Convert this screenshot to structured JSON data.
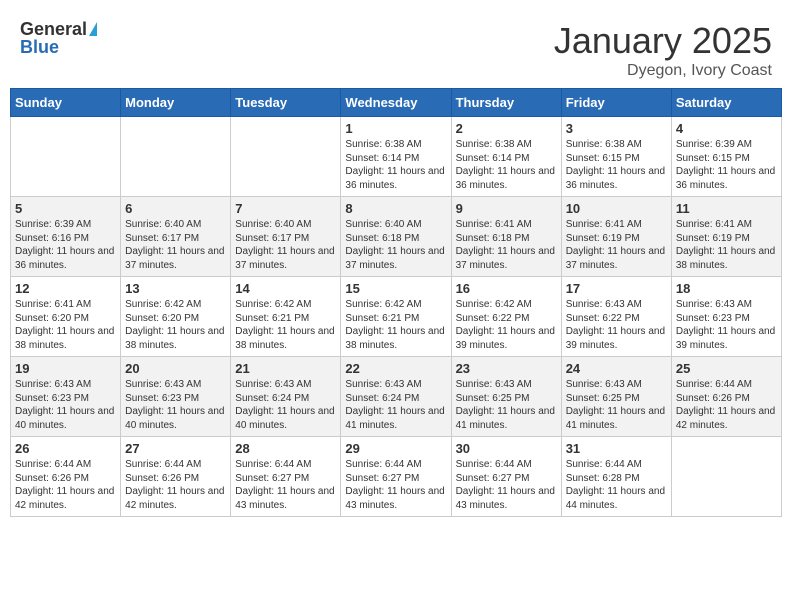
{
  "logo": {
    "general": "General",
    "blue": "Blue"
  },
  "title": {
    "month": "January 2025",
    "location": "Dyegon, Ivory Coast"
  },
  "weekdays": [
    "Sunday",
    "Monday",
    "Tuesday",
    "Wednesday",
    "Thursday",
    "Friday",
    "Saturday"
  ],
  "weeks": [
    [
      {
        "day": "",
        "info": ""
      },
      {
        "day": "",
        "info": ""
      },
      {
        "day": "",
        "info": ""
      },
      {
        "day": "1",
        "info": "Sunrise: 6:38 AM\nSunset: 6:14 PM\nDaylight: 11 hours and 36 minutes."
      },
      {
        "day": "2",
        "info": "Sunrise: 6:38 AM\nSunset: 6:14 PM\nDaylight: 11 hours and 36 minutes."
      },
      {
        "day": "3",
        "info": "Sunrise: 6:38 AM\nSunset: 6:15 PM\nDaylight: 11 hours and 36 minutes."
      },
      {
        "day": "4",
        "info": "Sunrise: 6:39 AM\nSunset: 6:15 PM\nDaylight: 11 hours and 36 minutes."
      }
    ],
    [
      {
        "day": "5",
        "info": "Sunrise: 6:39 AM\nSunset: 6:16 PM\nDaylight: 11 hours and 36 minutes."
      },
      {
        "day": "6",
        "info": "Sunrise: 6:40 AM\nSunset: 6:17 PM\nDaylight: 11 hours and 37 minutes."
      },
      {
        "day": "7",
        "info": "Sunrise: 6:40 AM\nSunset: 6:17 PM\nDaylight: 11 hours and 37 minutes."
      },
      {
        "day": "8",
        "info": "Sunrise: 6:40 AM\nSunset: 6:18 PM\nDaylight: 11 hours and 37 minutes."
      },
      {
        "day": "9",
        "info": "Sunrise: 6:41 AM\nSunset: 6:18 PM\nDaylight: 11 hours and 37 minutes."
      },
      {
        "day": "10",
        "info": "Sunrise: 6:41 AM\nSunset: 6:19 PM\nDaylight: 11 hours and 37 minutes."
      },
      {
        "day": "11",
        "info": "Sunrise: 6:41 AM\nSunset: 6:19 PM\nDaylight: 11 hours and 38 minutes."
      }
    ],
    [
      {
        "day": "12",
        "info": "Sunrise: 6:41 AM\nSunset: 6:20 PM\nDaylight: 11 hours and 38 minutes."
      },
      {
        "day": "13",
        "info": "Sunrise: 6:42 AM\nSunset: 6:20 PM\nDaylight: 11 hours and 38 minutes."
      },
      {
        "day": "14",
        "info": "Sunrise: 6:42 AM\nSunset: 6:21 PM\nDaylight: 11 hours and 38 minutes."
      },
      {
        "day": "15",
        "info": "Sunrise: 6:42 AM\nSunset: 6:21 PM\nDaylight: 11 hours and 38 minutes."
      },
      {
        "day": "16",
        "info": "Sunrise: 6:42 AM\nSunset: 6:22 PM\nDaylight: 11 hours and 39 minutes."
      },
      {
        "day": "17",
        "info": "Sunrise: 6:43 AM\nSunset: 6:22 PM\nDaylight: 11 hours and 39 minutes."
      },
      {
        "day": "18",
        "info": "Sunrise: 6:43 AM\nSunset: 6:23 PM\nDaylight: 11 hours and 39 minutes."
      }
    ],
    [
      {
        "day": "19",
        "info": "Sunrise: 6:43 AM\nSunset: 6:23 PM\nDaylight: 11 hours and 40 minutes."
      },
      {
        "day": "20",
        "info": "Sunrise: 6:43 AM\nSunset: 6:23 PM\nDaylight: 11 hours and 40 minutes."
      },
      {
        "day": "21",
        "info": "Sunrise: 6:43 AM\nSunset: 6:24 PM\nDaylight: 11 hours and 40 minutes."
      },
      {
        "day": "22",
        "info": "Sunrise: 6:43 AM\nSunset: 6:24 PM\nDaylight: 11 hours and 41 minutes."
      },
      {
        "day": "23",
        "info": "Sunrise: 6:43 AM\nSunset: 6:25 PM\nDaylight: 11 hours and 41 minutes."
      },
      {
        "day": "24",
        "info": "Sunrise: 6:43 AM\nSunset: 6:25 PM\nDaylight: 11 hours and 41 minutes."
      },
      {
        "day": "25",
        "info": "Sunrise: 6:44 AM\nSunset: 6:26 PM\nDaylight: 11 hours and 42 minutes."
      }
    ],
    [
      {
        "day": "26",
        "info": "Sunrise: 6:44 AM\nSunset: 6:26 PM\nDaylight: 11 hours and 42 minutes."
      },
      {
        "day": "27",
        "info": "Sunrise: 6:44 AM\nSunset: 6:26 PM\nDaylight: 11 hours and 42 minutes."
      },
      {
        "day": "28",
        "info": "Sunrise: 6:44 AM\nSunset: 6:27 PM\nDaylight: 11 hours and 43 minutes."
      },
      {
        "day": "29",
        "info": "Sunrise: 6:44 AM\nSunset: 6:27 PM\nDaylight: 11 hours and 43 minutes."
      },
      {
        "day": "30",
        "info": "Sunrise: 6:44 AM\nSunset: 6:27 PM\nDaylight: 11 hours and 43 minutes."
      },
      {
        "day": "31",
        "info": "Sunrise: 6:44 AM\nSunset: 6:28 PM\nDaylight: 11 hours and 44 minutes."
      },
      {
        "day": "",
        "info": ""
      }
    ]
  ]
}
